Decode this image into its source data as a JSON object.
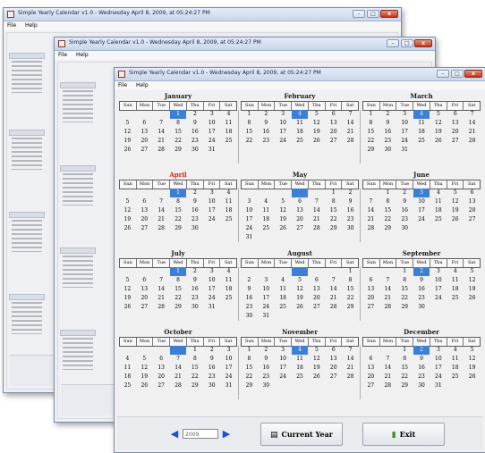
{
  "window_title": "Simple Yearly Calendar v1.0 -  Wednesday April 8, 2009,  at 05:24:27 PM",
  "window_controls": {
    "minimize": "–",
    "maximize": "□",
    "close": "x"
  },
  "menu": [
    "File",
    "Help"
  ],
  "weekdays": [
    "Sun",
    "Mon",
    "Tue",
    "Wed",
    "Thu",
    "Fri",
    "Sat"
  ],
  "months": [
    {
      "name": "January",
      "is_current": false,
      "highlight": 4,
      "weeks": [
        [
          "",
          "",
          "",
          "1",
          "2",
          "3",
          "4"
        ],
        [
          "5",
          "6",
          "7",
          "8",
          "9",
          "10",
          "11"
        ],
        [
          "12",
          "13",
          "14",
          "15",
          "16",
          "17",
          "18"
        ],
        [
          "19",
          "20",
          "21",
          "22",
          "23",
          "24",
          "25"
        ],
        [
          "26",
          "27",
          "28",
          "29",
          "30",
          "31",
          ""
        ]
      ]
    },
    {
      "name": "February",
      "is_current": false,
      "highlight": 1,
      "weeks": [
        [
          "1",
          "2",
          "3",
          "4",
          "5",
          "6",
          "7"
        ],
        [
          "8",
          "9",
          "10",
          "11",
          "12",
          "13",
          "14"
        ],
        [
          "15",
          "16",
          "17",
          "18",
          "19",
          "20",
          "21"
        ],
        [
          "22",
          "23",
          "24",
          "25",
          "26",
          "27",
          "28"
        ]
      ]
    },
    {
      "name": "March",
      "is_current": false,
      "highlight": 1,
      "weeks": [
        [
          "1",
          "2",
          "3",
          "4",
          "5",
          "6",
          "7"
        ],
        [
          "8",
          "9",
          "10",
          "11",
          "12",
          "13",
          "14"
        ],
        [
          "15",
          "16",
          "17",
          "18",
          "19",
          "20",
          "21"
        ],
        [
          "22",
          "23",
          "24",
          "25",
          "26",
          "27",
          "28"
        ],
        [
          "29",
          "30",
          "31",
          "",
          "",
          "",
          ""
        ]
      ]
    },
    {
      "name": "April",
      "is_current": true,
      "highlight": 1,
      "weeks": [
        [
          "",
          "",
          "",
          "1",
          "2",
          "3",
          "4"
        ],
        [
          "5",
          "6",
          "7",
          "8",
          "9",
          "10",
          "11"
        ],
        [
          "12",
          "13",
          "14",
          "15",
          "16",
          "17",
          "18"
        ],
        [
          "19",
          "20",
          "21",
          "22",
          "23",
          "24",
          "25"
        ],
        [
          "26",
          "27",
          "28",
          "29",
          "30",
          "",
          ""
        ]
      ]
    },
    {
      "name": "May",
      "is_current": false,
      "highlight": 1,
      "weeks": [
        [
          "",
          "",
          "",
          "",
          "",
          "1",
          "2"
        ],
        [
          "3",
          "4",
          "5",
          "6",
          "7",
          "8",
          "9"
        ],
        [
          "10",
          "11",
          "12",
          "13",
          "14",
          "15",
          "16"
        ],
        [
          "17",
          "18",
          "19",
          "20",
          "21",
          "22",
          "23"
        ],
        [
          "24",
          "25",
          "26",
          "27",
          "28",
          "29",
          "30"
        ],
        [
          "31",
          "",
          "",
          "",
          "",
          "",
          ""
        ]
      ]
    },
    {
      "name": "June",
      "is_current": false,
      "highlight": 1,
      "weeks": [
        [
          "",
          "1",
          "2",
          "3",
          "4",
          "5",
          "6"
        ],
        [
          "7",
          "8",
          "9",
          "10",
          "11",
          "12",
          "13"
        ],
        [
          "14",
          "15",
          "16",
          "17",
          "18",
          "19",
          "20"
        ],
        [
          "21",
          "22",
          "23",
          "24",
          "25",
          "26",
          "27"
        ],
        [
          "28",
          "29",
          "30",
          "",
          "",
          "",
          ""
        ]
      ]
    },
    {
      "name": "July",
      "is_current": false,
      "highlight": 1,
      "weeks": [
        [
          "",
          "",
          "",
          "1",
          "2",
          "3",
          "4"
        ],
        [
          "5",
          "6",
          "7",
          "8",
          "9",
          "10",
          "11"
        ],
        [
          "12",
          "13",
          "14",
          "15",
          "16",
          "17",
          "18"
        ],
        [
          "19",
          "20",
          "21",
          "22",
          "23",
          "24",
          "25"
        ],
        [
          "26",
          "27",
          "28",
          "29",
          "30",
          "31",
          ""
        ]
      ]
    },
    {
      "name": "August",
      "is_current": false,
      "highlight": 1,
      "weeks": [
        [
          "",
          "",
          "",
          "",
          "",
          "",
          "1"
        ],
        [
          "2",
          "3",
          "4",
          "5",
          "6",
          "7",
          "8"
        ],
        [
          "9",
          "10",
          "11",
          "12",
          "13",
          "14",
          "15"
        ],
        [
          "16",
          "17",
          "18",
          "19",
          "20",
          "21",
          "22"
        ],
        [
          "23",
          "24",
          "25",
          "26",
          "27",
          "28",
          "29"
        ],
        [
          "30",
          "31",
          "",
          "",
          "",
          "",
          ""
        ]
      ]
    },
    {
      "name": "September",
      "is_current": false,
      "highlight": 1,
      "weeks": [
        [
          "",
          "",
          "1",
          "2",
          "3",
          "4",
          "5"
        ],
        [
          "6",
          "7",
          "8",
          "9",
          "10",
          "11",
          "12"
        ],
        [
          "13",
          "14",
          "15",
          "16",
          "17",
          "18",
          "19"
        ],
        [
          "20",
          "21",
          "22",
          "23",
          "24",
          "25",
          "26"
        ],
        [
          "27",
          "28",
          "29",
          "30",
          "",
          "",
          ""
        ]
      ]
    },
    {
      "name": "October",
      "is_current": false,
      "highlight": 1,
      "weeks": [
        [
          "",
          "",
          "",
          "",
          "1",
          "2",
          "3"
        ],
        [
          "4",
          "5",
          "6",
          "7",
          "8",
          "9",
          "10"
        ],
        [
          "11",
          "12",
          "13",
          "14",
          "15",
          "16",
          "17"
        ],
        [
          "18",
          "19",
          "20",
          "21",
          "22",
          "23",
          "24"
        ],
        [
          "25",
          "26",
          "27",
          "28",
          "29",
          "30",
          "31"
        ]
      ]
    },
    {
      "name": "November",
      "is_current": false,
      "highlight": 1,
      "weeks": [
        [
          "1",
          "2",
          "3",
          "4",
          "5",
          "6",
          "7"
        ],
        [
          "8",
          "9",
          "10",
          "11",
          "12",
          "13",
          "14"
        ],
        [
          "15",
          "16",
          "17",
          "18",
          "19",
          "20",
          "21"
        ],
        [
          "22",
          "23",
          "24",
          "25",
          "26",
          "27",
          "28"
        ],
        [
          "29",
          "30",
          "",
          "",
          "",
          "",
          ""
        ]
      ]
    },
    {
      "name": "December",
      "is_current": false,
      "highlight": 1,
      "weeks": [
        [
          "",
          "",
          "1",
          "2",
          "3",
          "4",
          "5"
        ],
        [
          "6",
          "7",
          "8",
          "9",
          "10",
          "11",
          "12"
        ],
        [
          "13",
          "14",
          "15",
          "16",
          "17",
          "18",
          "19"
        ],
        [
          "20",
          "21",
          "22",
          "23",
          "24",
          "25",
          "26"
        ],
        [
          "27",
          "28",
          "29",
          "30",
          "31",
          "",
          ""
        ]
      ]
    }
  ],
  "footer": {
    "prev_arrow": "◀",
    "next_arrow": "▶",
    "year_value": "2009",
    "current_year_label": "Current Year",
    "exit_label": "Exit",
    "current_year_icon": "calendar-icon",
    "exit_icon": "exit-door-icon"
  },
  "colors": {
    "highlight": "#3d7fd4",
    "current_month": "#d22020"
  }
}
